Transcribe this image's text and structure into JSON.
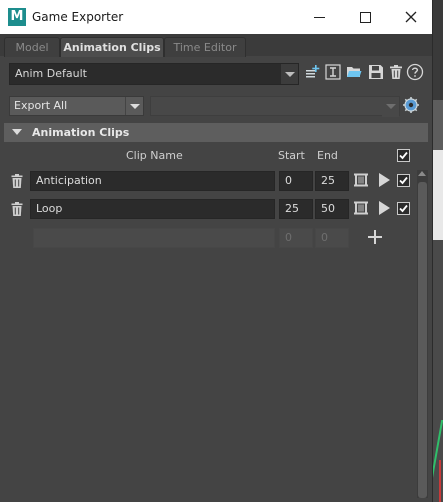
{
  "window": {
    "title": "Game Exporter",
    "app_logo": "M"
  },
  "tabs": [
    {
      "label": "Model",
      "active": false
    },
    {
      "label": "Animation Clips",
      "active": true
    },
    {
      "label": "Time Editor",
      "active": false
    }
  ],
  "preset": {
    "value": "Anim Default",
    "icons": [
      "new-preset-icon",
      "rename-preset-icon",
      "open-preset-icon",
      "save-preset-icon",
      "delete-preset-icon",
      "help-icon"
    ]
  },
  "export": {
    "mode": "Export All",
    "path_value": ""
  },
  "section": {
    "title": "Animation Clips"
  },
  "columns": {
    "clip_name": "Clip Name",
    "start": "Start",
    "end": "End"
  },
  "clips": [
    {
      "name": "Anticipation",
      "start": "0",
      "end": "25",
      "checked": true
    },
    {
      "name": "Loop",
      "start": "25",
      "end": "50",
      "checked": true
    }
  ],
  "new_clip": {
    "name": "",
    "start": "0",
    "end": "0"
  },
  "colors": {
    "accent": "#1d8d8d",
    "panel": "#444444",
    "field": "#2b2b2b",
    "header": "#5e5e5e"
  }
}
